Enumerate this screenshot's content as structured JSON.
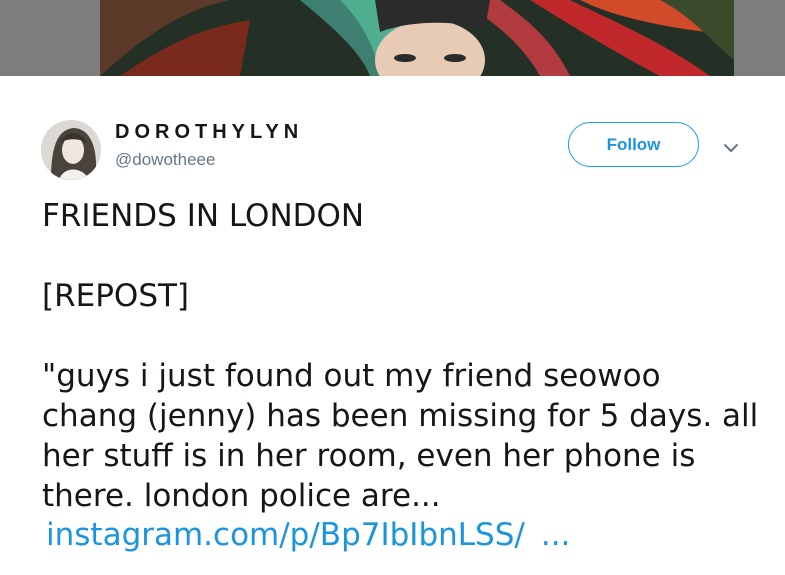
{
  "author": {
    "display_name": "DOROTHYLYN",
    "handle": "@dowotheee"
  },
  "actions": {
    "follow_label": "Follow"
  },
  "tweet": {
    "line1": "FRIENDS IN LONDON",
    "line2": "[REPOST]",
    "line3": "\"guys i just found out my friend seowoo chang (jenny) has been missing for 5 days. all her stuff is in her room, even her phone is there. london police are...",
    "link": "instagram.com/p/Bp7IbIbnLSS/",
    "ellipsis": "..."
  },
  "colors": {
    "link": "#1b95e0",
    "follow_border": "#1da1f2",
    "secondary_text": "#657786"
  },
  "icons": {
    "caret": "chevron-down-icon"
  }
}
